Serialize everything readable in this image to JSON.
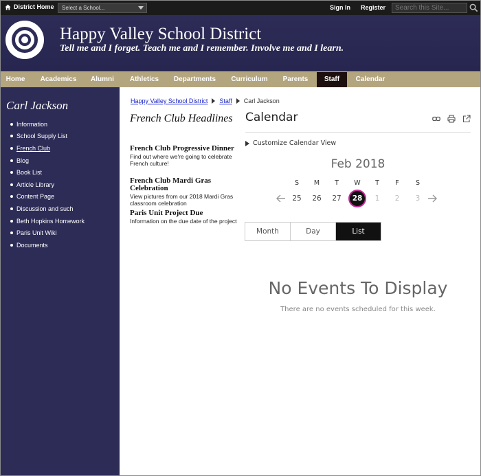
{
  "topbar": {
    "home_label": "District Home",
    "school_select": "Select a School...",
    "signin": "Sign In",
    "register": "Register",
    "search_placeholder": "Search this Site..."
  },
  "header": {
    "title": "Happy Valley School District",
    "tagline": "Tell me and I forget. Teach me and I remember. Involve me and I learn.",
    "bg_color": "#2d2c57"
  },
  "nav": {
    "items": [
      "Home",
      "Academics",
      "Alumni",
      "Athletics",
      "Departments",
      "Curriculum",
      "Parents",
      "Staff",
      "Calendar"
    ],
    "active": "Staff"
  },
  "sidebar": {
    "heading": "Carl Jackson",
    "items": [
      "Information",
      "School Supply List",
      "French Club",
      "Blog",
      "Book List",
      "Article Library",
      "Content Page",
      "Discussion and such",
      "Beth Hopkins Homework",
      "Paris Unit Wiki",
      "Documents"
    ],
    "current": "French Club"
  },
  "breadcrumb": {
    "items": [
      "Happy Valley School District",
      "Staff"
    ],
    "current": "Carl Jackson"
  },
  "headlines": {
    "title": "French Club Headlines",
    "items": [
      {
        "title": "French Club Progressive Dinner",
        "desc": "Find out where we're going to celebrate French culture!"
      },
      {
        "title": "French Club Mardi Gras Celebration",
        "desc": "View pictures from our 2018 Mardi Gras classroom celebration"
      },
      {
        "title": "Paris Unit Project Due",
        "desc": "Information on the due date of the project"
      }
    ]
  },
  "calendar": {
    "title": "Calendar",
    "customize": "Customize Calendar View",
    "month": "Feb 2018",
    "weekdays": [
      "S",
      "M",
      "T",
      "W",
      "T",
      "F",
      "S"
    ],
    "days": [
      "25",
      "26",
      "27",
      "28",
      "1",
      "2",
      "3"
    ],
    "today": "28",
    "views": [
      "Month",
      "Day",
      "List"
    ],
    "active_view": "List",
    "empty_title": "No Events To Display",
    "empty_sub": "There are no events scheduled for this week.",
    "today_ring_color": "#c22c97"
  }
}
